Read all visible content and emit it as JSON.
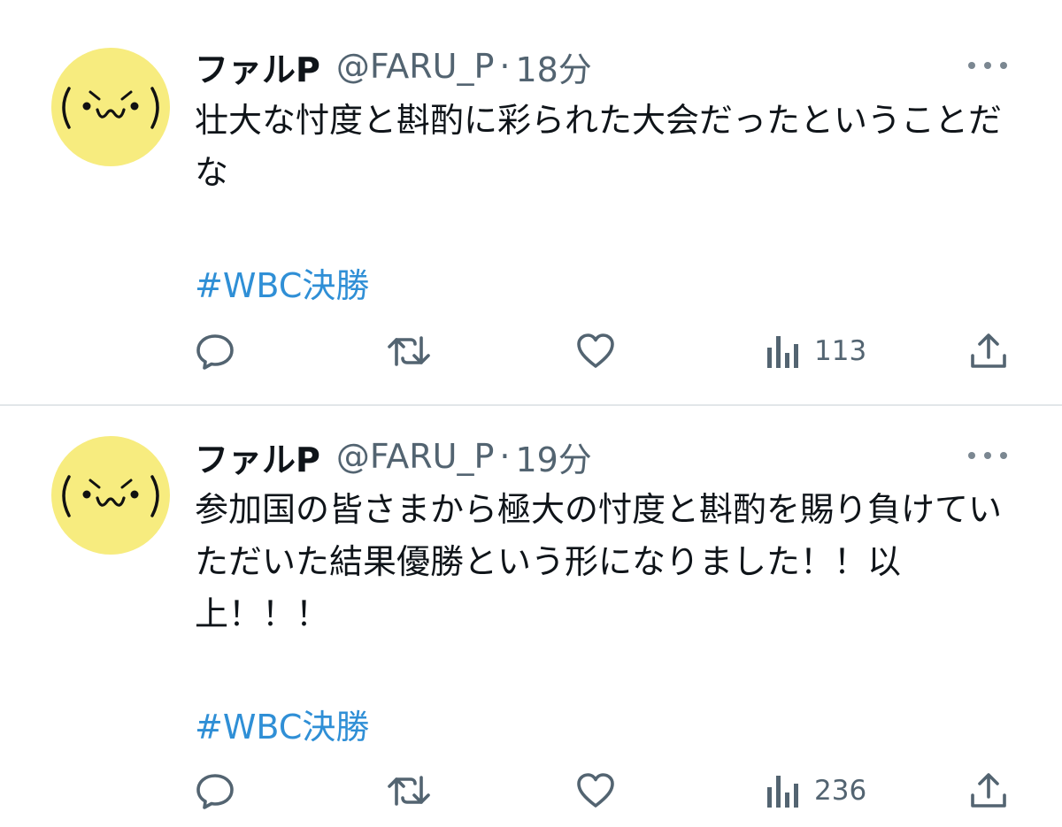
{
  "tweets": [
    {
      "name": "ファルP",
      "handle": "@FARU_P",
      "separator": "·",
      "time": "18分",
      "avatar_text": "(•̀ω•́)",
      "text": "壮大な忖度と斟酌に彩られた大会だったということだな",
      "hashtag": "#WBC決勝",
      "views": "113"
    },
    {
      "name": "ファルP",
      "handle": "@FARU_P",
      "separator": "·",
      "time": "19分",
      "avatar_text": "(•̀ω•́)",
      "text": "参加国の皆さまから極大の忖度と斟酌を賜り負けていただいた結果優勝という形になりました！！以上！！！",
      "hashtag": "#WBC決勝",
      "views": "236"
    }
  ],
  "icons": [
    "reply-icon",
    "retweet-icon",
    "like-icon",
    "views-icon",
    "share-icon",
    "more-icon"
  ],
  "colors": {
    "avatar_bg": "#f7ec7f",
    "hashtag": "#2f8fd6",
    "secondary_text": "#536471",
    "divider": "#e2e6e9"
  }
}
